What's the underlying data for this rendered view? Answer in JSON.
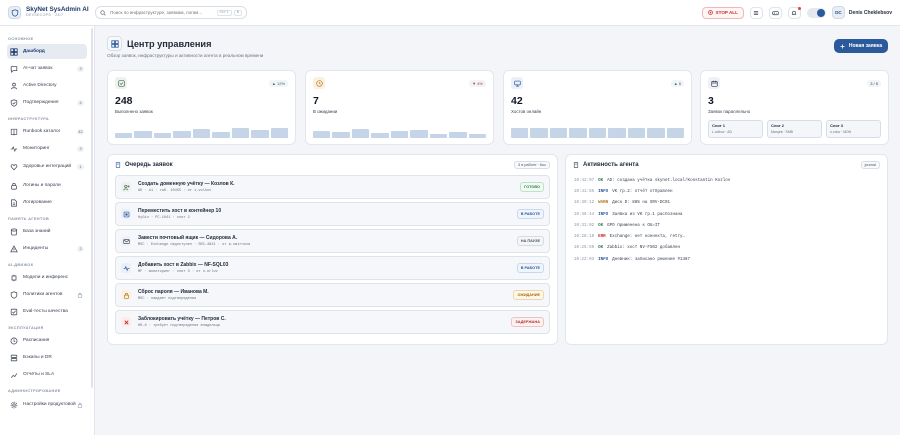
{
  "brand": {
    "name": "SkyNet SysAdmin AI",
    "subtitle": "DEVSECOPS · 24/7"
  },
  "search": {
    "placeholder": "Поиск по инфраструктуре, заявкам, логам...",
    "shortcut_1": "Ctrl",
    "shortcut_2": "K"
  },
  "topbar": {
    "stop_label": "STOP ALL",
    "avatar_initials": "DC",
    "user_name": "Denis Cheklebsov"
  },
  "sidebar": {
    "sections": [
      {
        "title": "Основное",
        "items": [
          {
            "label": "Дашборд",
            "icon": "dashboard-icon",
            "active": true
          },
          {
            "label": "AI-чат заявок",
            "icon": "chat-icon",
            "count": "3"
          },
          {
            "label": "Active Directory",
            "icon": "directory-icon"
          },
          {
            "label": "Подтверждения",
            "icon": "check-shield-icon",
            "count": "4"
          }
        ]
      },
      {
        "title": "Инфраструктура",
        "items": [
          {
            "label": "Runbook каталог",
            "icon": "book-icon",
            "count": "42"
          },
          {
            "label": "Мониторинг",
            "icon": "pulse-icon",
            "count": "3"
          },
          {
            "label": "Здоровье интеграций",
            "icon": "heart-icon",
            "count": "1",
            "tall": true
          },
          {
            "label": "Логины и пароли",
            "icon": "lock-icon"
          },
          {
            "label": "Логирование",
            "icon": "file-icon"
          }
        ]
      },
      {
        "title": "Память агентов",
        "items": [
          {
            "label": "База знаний",
            "icon": "database-icon"
          },
          {
            "label": "Инциденты",
            "icon": "alert-icon",
            "count": "2"
          }
        ]
      },
      {
        "title": "AI-движок",
        "items": [
          {
            "label": "Модели и инференс",
            "icon": "cpu-icon"
          },
          {
            "label": "Политики агентов",
            "icon": "policy-icon",
            "locked": true
          },
          {
            "label": "Eval-тесты качества",
            "icon": "test-icon"
          }
        ]
      },
      {
        "title": "Эксплуатация",
        "items": [
          {
            "label": "Расписания",
            "icon": "clock-icon"
          },
          {
            "label": "Бэкапы и DR",
            "icon": "backup-icon"
          },
          {
            "label": "Отчёты и SLA",
            "icon": "chart-icon"
          }
        ]
      },
      {
        "title": "Администрирование",
        "items": [
          {
            "label": "Настройки продуктовой",
            "icon": "gear-icon",
            "locked": true,
            "tall": true
          }
        ]
      }
    ]
  },
  "page": {
    "title": "Центр управления",
    "subtitle": "Обзор заявок, инфраструктуры и активности агента в реальном времени",
    "new_button": "Новая заявка"
  },
  "stats": [
    {
      "value": "248",
      "label": "Выполнено заявок",
      "delta": "▲ 12%",
      "trend": "up",
      "icon": "check-square-icon",
      "accent": "#eef2ec",
      "bars": [
        0.45,
        0.6,
        0.4,
        0.55,
        0.75,
        0.5,
        0.8,
        0.7,
        0.85
      ]
    },
    {
      "value": "7",
      "label": "В ожидании",
      "delta": "▼ 4%",
      "trend": "down",
      "icon": "clock-icon",
      "accent": "#fbf1e2",
      "bars": [
        0.55,
        0.5,
        0.75,
        0.45,
        0.6,
        0.7,
        0.35,
        0.5,
        0.35
      ]
    },
    {
      "value": "42",
      "label": "Хостов онлайн",
      "delta": "▲ 8",
      "trend": "neutral",
      "icon": "monitor-icon",
      "accent": "#eaf0f8",
      "bars": [
        0.8,
        0.8,
        0.8,
        0.85,
        0.8,
        0.8,
        0.85,
        0.8,
        0.85
      ]
    },
    {
      "value": "3",
      "label": "Заявок параллельно",
      "delta": "3 / 5",
      "trend": "neutral",
      "icon": "calendar-icon",
      "accent": "#eef1f6",
      "slots": [
        {
          "name": "Слот 1",
          "info": "L.volkov · AD"
        },
        {
          "name": "Слот 2",
          "info": "Мигцев · SMB"
        },
        {
          "name": "Слот 3",
          "info": "n.orlov · MON"
        }
      ]
    }
  ],
  "queue": {
    "title": "Очередь заявок",
    "chip": "3 в работе · 6ос",
    "tickets": [
      {
        "title": "Создать доменную учётку — Козлов К.",
        "meta": "AD · #1 · таб. 10455 · от i.volkov",
        "status": "ГОТОВО",
        "kind": "done",
        "icon": "user-plus-icon"
      },
      {
        "title": "Переместить хост в контейнер 10",
        "meta": "HyGin · PC-1041 · слот 2",
        "status": "В РАБОТЕ",
        "kind": "work",
        "icon": "box-icon"
      },
      {
        "title": "Завести почтовый ящик — Сидорова А.",
        "meta": "MSC · Exchange недоступен · SRC-4821 · от a.smirnova",
        "status": "НА ПАУЗЕ",
        "kind": "pause",
        "icon": "mail-icon"
      },
      {
        "title": "Добавить хост в Zabbix — NF-SQL03",
        "meta": "MF · мониторинг · слот 3 · от n.orlov",
        "status": "В РАБОТЕ",
        "kind": "work",
        "icon": "pulse-icon"
      },
      {
        "title": "Сброс пароля — Иванова М.",
        "meta": "MSC · ожидает подтверждения",
        "status": "ОЖИДАНИЕ",
        "kind": "wait",
        "icon": "lock-icon"
      },
      {
        "title": "Заблокировать учётку — Петров С.",
        "meta": "HR-8 · требует подтверждения владельца",
        "status": "ЗАДЕРЖАНА",
        "kind": "hold",
        "icon": "x-icon"
      }
    ]
  },
  "activity": {
    "title": "Активность агента",
    "chip": "journal",
    "lines": [
      {
        "time": "10:42:07",
        "level": "OK",
        "text": "AD: создана учётка skynet.local/Konstantin Kozlov"
      },
      {
        "time": "10:41:55",
        "level": "INFO",
        "text": "VK гр.2: отчёт отправлен"
      },
      {
        "time": "10:39:12",
        "level": "WARN",
        "text": "Диск D: 88% на SRV-DC01"
      },
      {
        "time": "10:36:44",
        "level": "INFO",
        "text": "Заявка из VK гр.1 распознана"
      },
      {
        "time": "10:31:02",
        "level": "OK",
        "text": "GPO применена к OU=IT"
      },
      {
        "time": "10:28:19",
        "level": "ERR",
        "text": "Exchange: нет коннекта, retry…"
      },
      {
        "time": "10:25:50",
        "level": "OK",
        "text": "Zabbix: хост NV-FS02 добавлен"
      },
      {
        "time": "10:22:03",
        "level": "INFO",
        "text": "Дневник: записано решение #1487"
      }
    ]
  },
  "colors": {
    "accent": "#2b5a9c",
    "danger": "#c53030",
    "success": "#2f7a4a",
    "warning": "#b7791f",
    "bar": "#c5d4e6"
  }
}
